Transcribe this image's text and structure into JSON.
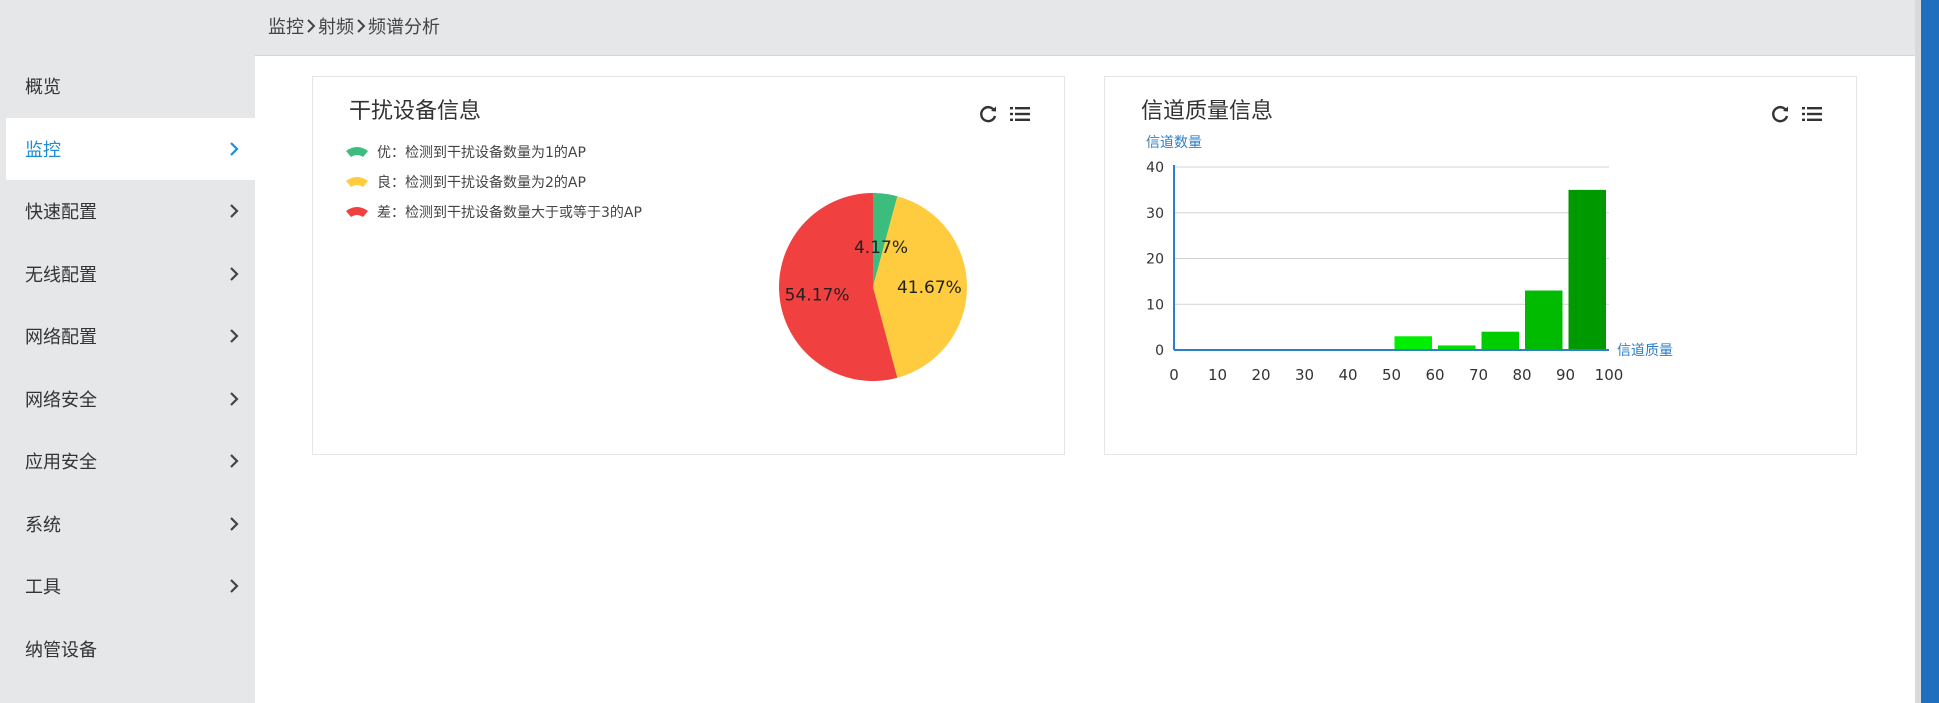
{
  "breadcrumb": [
    "监控",
    "射频",
    "频谱分析"
  ],
  "sidebar": {
    "items": [
      {
        "label": "概览",
        "chevron": false,
        "active": false
      },
      {
        "label": "监控",
        "chevron": true,
        "active": true
      },
      {
        "label": "快速配置",
        "chevron": true,
        "active": false
      },
      {
        "label": "无线配置",
        "chevron": true,
        "active": false
      },
      {
        "label": "网络配置",
        "chevron": true,
        "active": false
      },
      {
        "label": "网络安全",
        "chevron": true,
        "active": false
      },
      {
        "label": "应用安全",
        "chevron": true,
        "active": false
      },
      {
        "label": "系统",
        "chevron": true,
        "active": false
      },
      {
        "label": "工具",
        "chevron": true,
        "active": false
      },
      {
        "label": "纳管设备",
        "chevron": false,
        "active": false
      }
    ]
  },
  "interference_panel": {
    "title": "干扰设备信息",
    "legend": [
      {
        "label": "优：检测到干扰设备数量为1的AP",
        "color": "#3dbd7d"
      },
      {
        "label": "良：检测到干扰设备数量为2的AP",
        "color": "#ffcc3f"
      },
      {
        "label": "差：检测到干扰设备数量大于或等于3的AP",
        "color": "#f04040"
      }
    ]
  },
  "channel_panel": {
    "title": "信道质量信息"
  },
  "chart_data": [
    {
      "type": "pie",
      "title": "",
      "slices": [
        {
          "name": "优",
          "value": 4.17,
          "label": "4.17%",
          "color": "#3dbd7d"
        },
        {
          "name": "良",
          "value": 41.67,
          "label": "41.67%",
          "color": "#ffcc3f"
        },
        {
          "name": "差",
          "value": 54.17,
          "label": "54.17%",
          "color": "#f04040"
        }
      ]
    },
    {
      "type": "bar",
      "title": "",
      "xlabel": "信道质量",
      "ylabel": "信道数量",
      "xlim": [
        0,
        100
      ],
      "ylim": [
        0,
        40
      ],
      "xticks": [
        "0",
        "10",
        "20",
        "30",
        "40",
        "50",
        "60",
        "70",
        "80",
        "90",
        "100"
      ],
      "yticks": [
        "0",
        "10",
        "20",
        "30",
        "40"
      ],
      "grid": true,
      "bars": [
        {
          "x_start": 50,
          "x_end": 60,
          "value": 3,
          "color": "#00ee00"
        },
        {
          "x_start": 60,
          "x_end": 70,
          "value": 1,
          "color": "#00dd00"
        },
        {
          "x_start": 70,
          "x_end": 80,
          "value": 4,
          "color": "#00cc00"
        },
        {
          "x_start": 80,
          "x_end": 90,
          "value": 13,
          "color": "#00bb00"
        },
        {
          "x_start": 90,
          "x_end": 100,
          "value": 35,
          "color": "#009900"
        }
      ]
    }
  ]
}
